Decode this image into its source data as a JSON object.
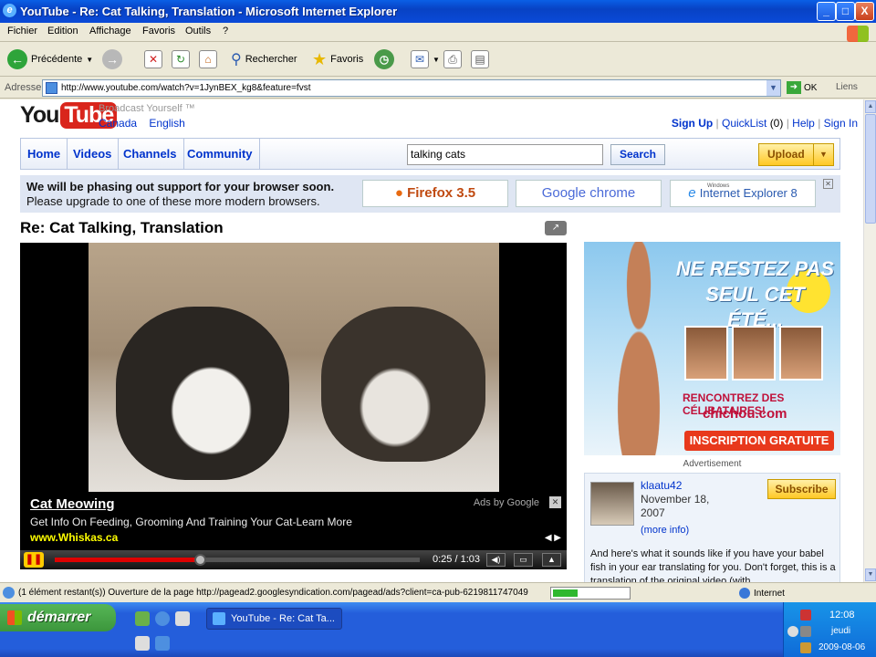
{
  "window": {
    "title": "YouTube - Re: Cat Talking, Translation - Microsoft Internet Explorer",
    "controls": [
      "_",
      "□",
      "X"
    ]
  },
  "menu": [
    "Fichier",
    "Edition",
    "Affichage",
    "Favoris",
    "Outils",
    "?"
  ],
  "toolbar": {
    "back": "Précédente",
    "search": "Rechercher",
    "favorites": "Favoris"
  },
  "address": {
    "label": "Adresse",
    "url": "http://www.youtube.com/watch?v=1JynBEX_kg8&feature=fvst",
    "go": "OK",
    "links": "Liens"
  },
  "youtube": {
    "logo_you": "You",
    "logo_tube": "Tube",
    "tagline": "Broadcast Yourself ™",
    "locale": [
      "Canada",
      "English"
    ],
    "user_links": {
      "signup": "Sign Up",
      "quicklist": "QuickList",
      "quicklist_count": "(0)",
      "help": "Help",
      "signin": "Sign In"
    },
    "nav": [
      "Home",
      "Videos",
      "Channels",
      "Community"
    ],
    "search_value": "talking cats",
    "search_button": "Search",
    "upload_button": "Upload",
    "browser_notice": {
      "line1": "We will be phasing out support for your browser soon.",
      "line2": "Please upgrade to one of these more modern browsers.",
      "browsers": [
        "Firefox 3.5",
        "Google chrome",
        "Internet Explorer 8"
      ],
      "ie_small": "Windows"
    },
    "video_title": "Re: Cat Talking, Translation",
    "player": {
      "ad_headline": "Cat Meowing",
      "ad_desc": "Get Info On Feeding, Grooming And Training Your Cat-Learn More",
      "ad_url": "www.Whiskas.ca",
      "ads_by": "Ads by Google",
      "time": "0:25 / 1:03",
      "progress": 0.397
    },
    "banner": {
      "headline": "NE RESTEZ PAS SEUL CET ÉTÉ...",
      "subline": "RENCONTREZ DES CÉLIBATAIRES!",
      "brand": "chichou.com",
      "cta": "INSCRIPTION GRATUITE"
    },
    "ad_label": "Advertisement",
    "uploader": {
      "name": "klaatu42",
      "date": "November 18, 2007",
      "more": "(more info)",
      "subscribe": "Subscribe",
      "desc": "And here's what it sounds like if you have your babel fish in your ear translating for you. Don't forget, this is a translation of the original video (with"
    }
  },
  "status": {
    "text": "(1 élément restant(s)) Ouverture de la page http://pagead2.googlesyndication.com/pagead/ads?client=ca-pub-6219811747049",
    "zone": "Internet",
    "progress": 0.33
  },
  "taskbar": {
    "start": "démarrer",
    "task": "YouTube - Re: Cat Ta...",
    "time": "12:08",
    "day": "jeudi",
    "date": "2009-08-06"
  }
}
